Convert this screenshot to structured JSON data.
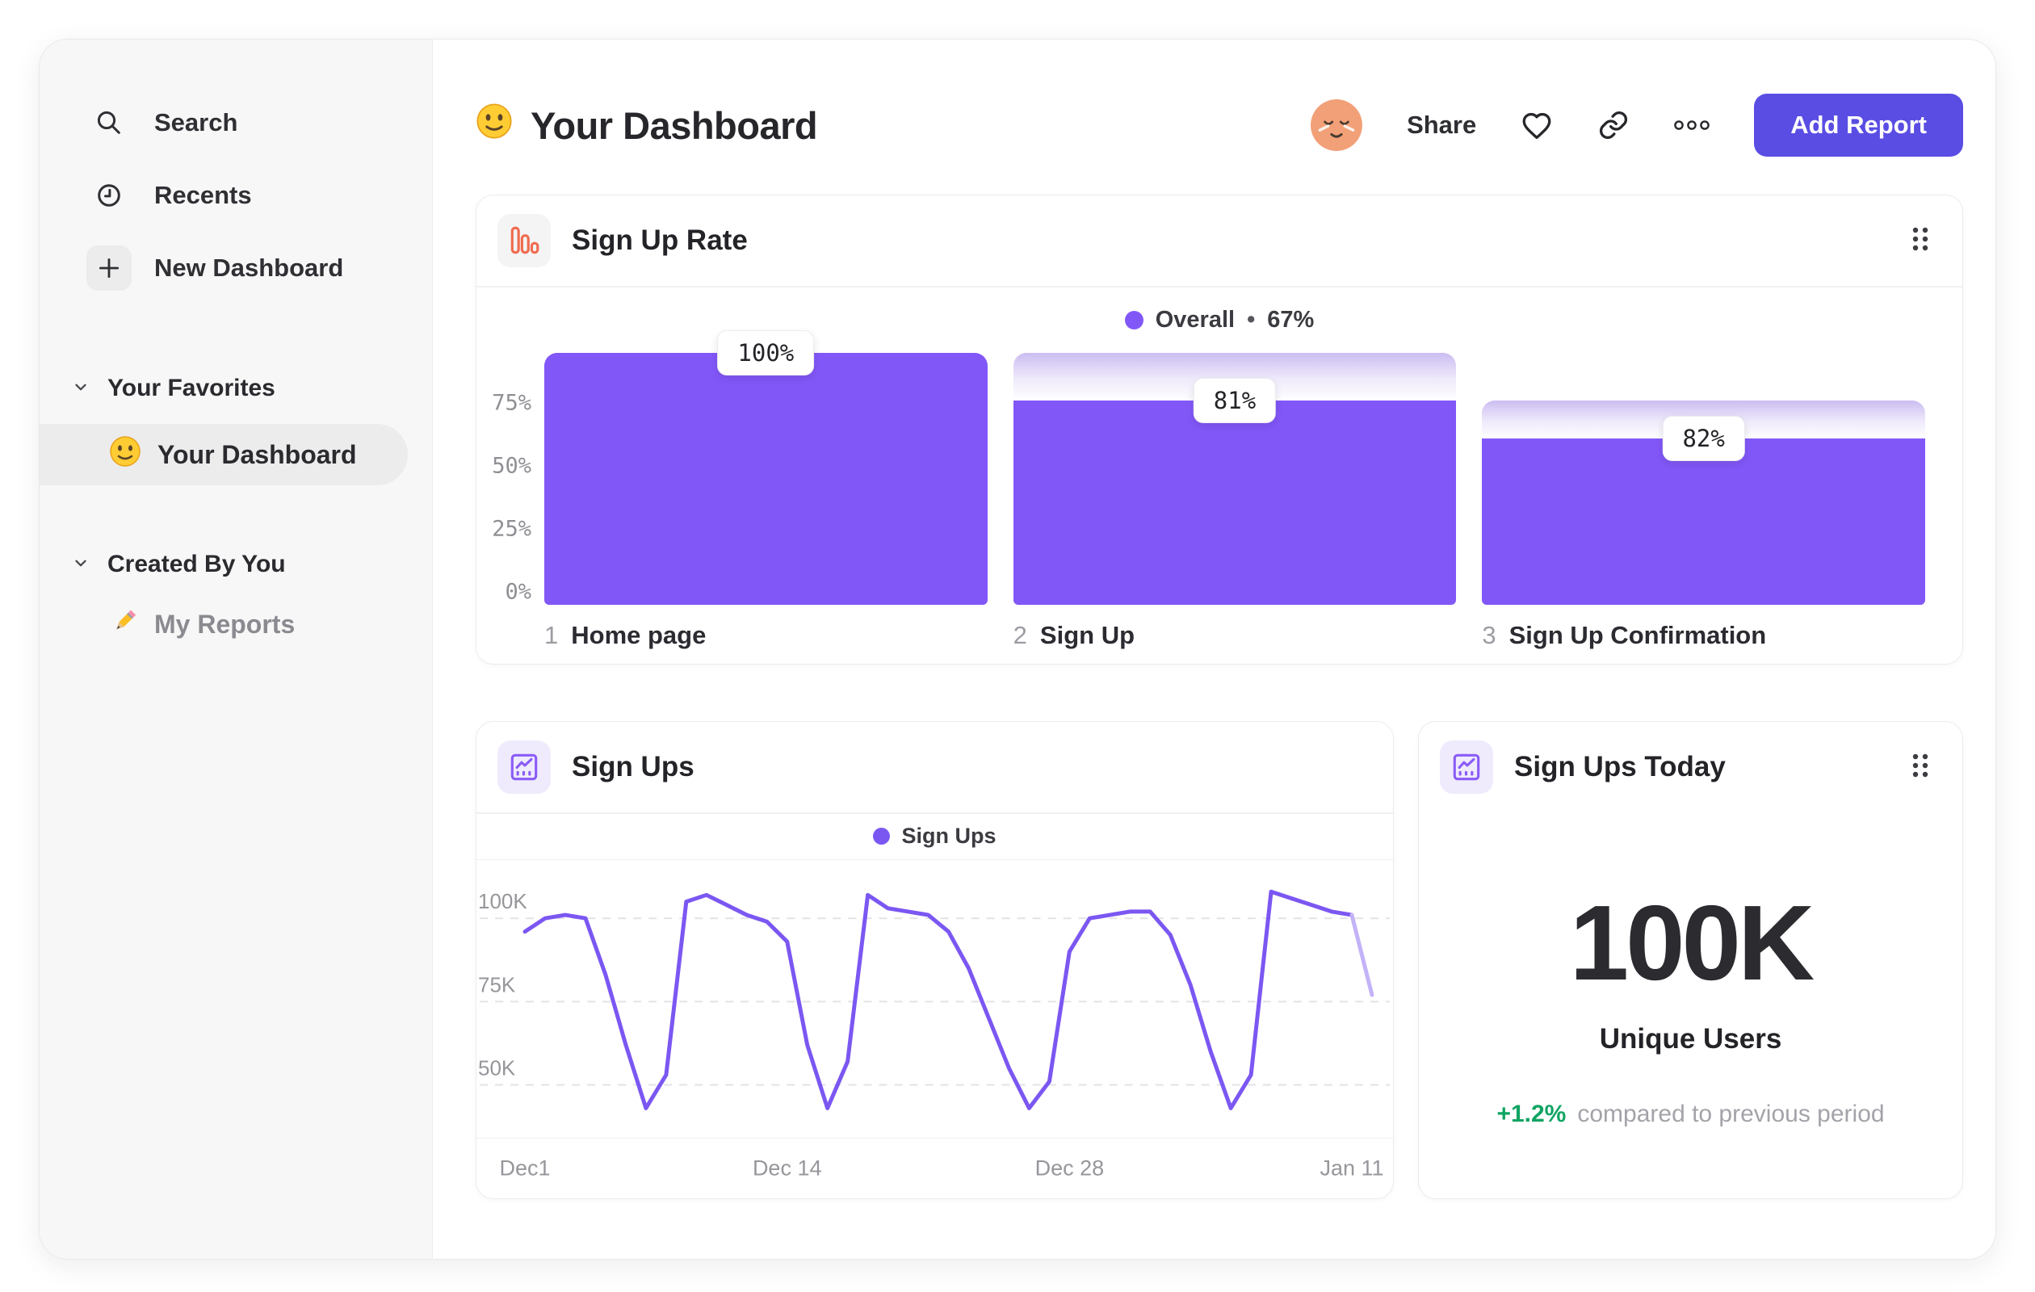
{
  "sidebar": {
    "items": [
      {
        "label": "Search"
      },
      {
        "label": "Recents"
      },
      {
        "label": "New Dashboard"
      }
    ],
    "sections": [
      {
        "label": "Your Favorites",
        "items": [
          {
            "label": "Your Dashboard",
            "selected": true
          }
        ]
      },
      {
        "label": "Created By You",
        "items": [
          {
            "label": "My Reports"
          }
        ]
      }
    ]
  },
  "header": {
    "title": "Your Dashboard",
    "share_label": "Share",
    "add_report_label": "Add Report"
  },
  "cards": {
    "signup_rate": {
      "title": "Sign Up Rate",
      "legend_label": "Overall",
      "legend_sep": "•",
      "legend_value": "67%"
    },
    "signups": {
      "title": "Sign Ups",
      "legend_label": "Sign Ups"
    },
    "signups_today": {
      "title": "Sign Ups Today",
      "value": "100K",
      "value_label": "Unique Users",
      "delta": "+1.2%",
      "delta_caption": "compared to previous period"
    }
  },
  "colors": {
    "accent_purple": "#8257f8",
    "line_purple": "#7b57f2",
    "line_faded": "#c3b2f7",
    "button_indigo": "#5a4de3",
    "delta_green": "#0fa463",
    "funnel_icon_orange": "#f06b4f"
  },
  "chart_data": [
    {
      "type": "bar",
      "title": "Sign Up Rate",
      "legend": "Overall",
      "overall_value": "67%",
      "step_numbers": [
        "1",
        "2",
        "3"
      ],
      "categories": [
        "Home page",
        "Sign Up",
        "Sign Up Confirmation"
      ],
      "values": [
        100,
        81,
        82
      ],
      "absolute_pct": [
        100,
        81,
        66
      ],
      "labels": [
        "100%",
        "81%",
        "82%"
      ],
      "y_ticks": [
        {
          "label": "75%",
          "value": 75
        },
        {
          "label": "50%",
          "value": 50
        },
        {
          "label": "25%",
          "value": 25
        },
        {
          "label": "0%",
          "value": 0
        }
      ],
      "ylim": [
        0,
        100
      ],
      "bar_color": "#8257f8",
      "legend_position": "top-center"
    },
    {
      "type": "line",
      "title": "Sign Ups",
      "legend": "Sign Ups",
      "unit": "K users",
      "x_start": "Dec 1",
      "x_ticks": [
        {
          "label": "Dec1",
          "day": 0
        },
        {
          "label": "Dec 14",
          "day": 13
        },
        {
          "label": "Dec 28",
          "day": 27
        },
        {
          "label": "Jan 11",
          "day": 41
        }
      ],
      "y_ticks": [
        {
          "label": "100K",
          "value": 100
        },
        {
          "label": "75K",
          "value": 75
        },
        {
          "label": "50K",
          "value": 50
        }
      ],
      "ylim": [
        34,
        117.5
      ],
      "grid": "dashed-horizontal",
      "values": [
        96,
        100,
        101,
        100,
        83,
        62,
        43,
        53,
        105,
        107,
        104,
        101,
        99,
        93,
        62,
        43,
        57,
        107,
        103,
        102,
        101,
        96,
        85,
        70,
        55,
        43,
        51,
        90,
        100,
        101,
        102,
        102,
        95,
        80,
        60,
        43,
        53,
        108,
        106,
        104,
        102,
        101,
        77
      ],
      "incomplete_tail_points": 1,
      "line_color": "#7b57f2"
    }
  ]
}
